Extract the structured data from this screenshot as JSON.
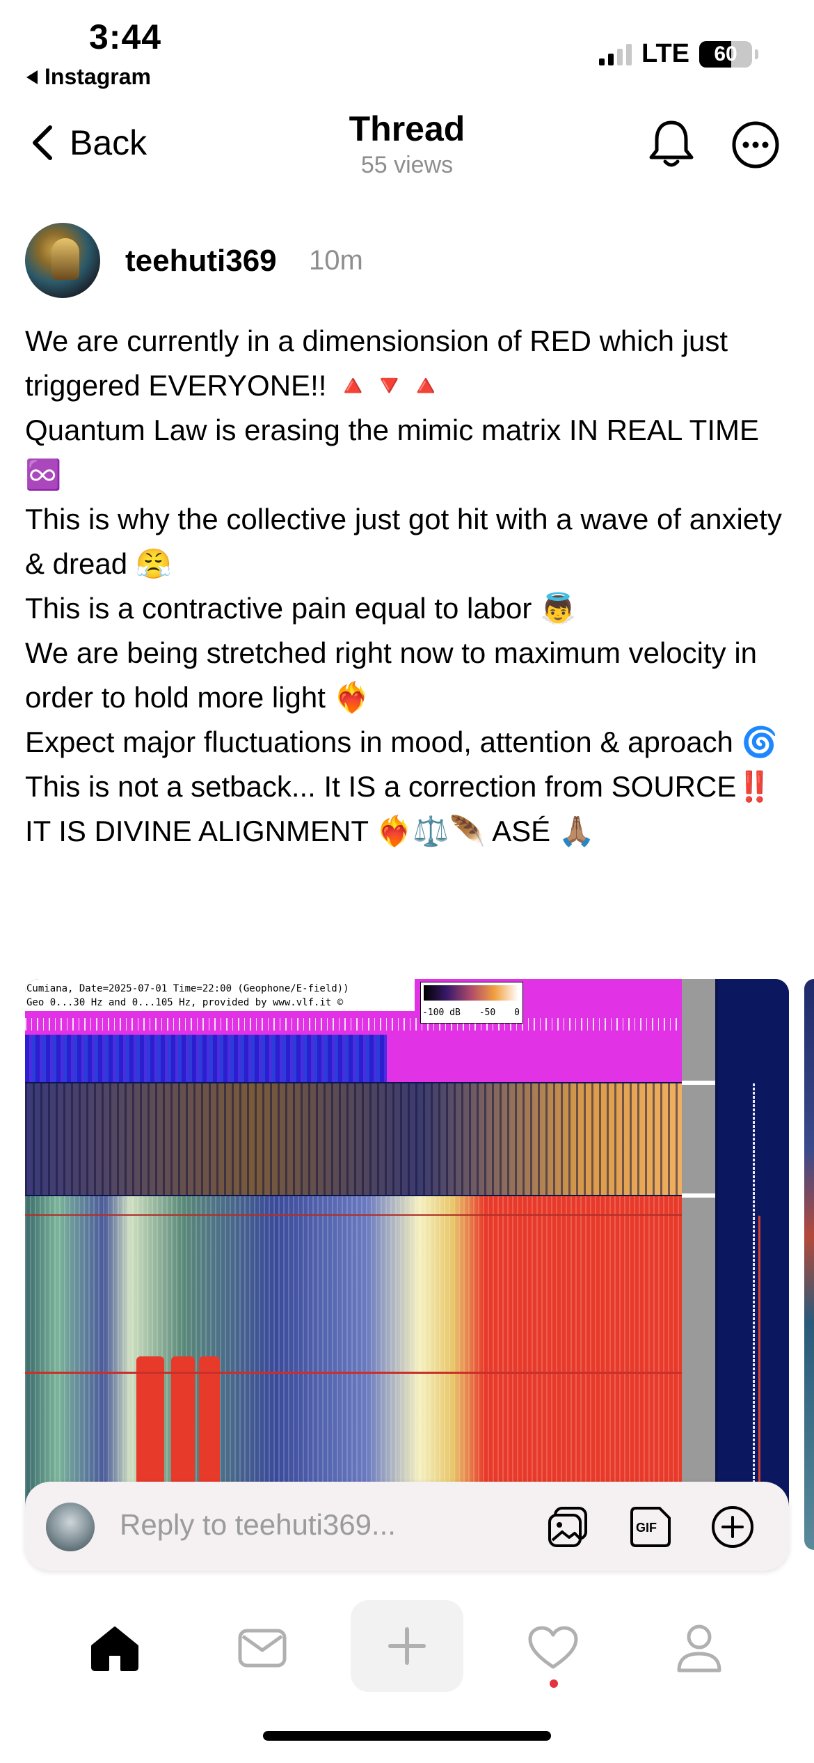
{
  "status_bar": {
    "time": "3:44",
    "back_app": "Instagram",
    "network": "LTE",
    "battery": "60",
    "battery_level": 0.6
  },
  "nav": {
    "back_label": "Back",
    "title": "Thread",
    "subtitle": "55 views",
    "icons": [
      "chevron-left-icon",
      "bell-icon",
      "more-icon"
    ]
  },
  "post": {
    "username": "teehuti369",
    "time": "10m",
    "lines": [
      "We are currently in a dimensionsion of RED which just triggered EVERYONE!! 🔺🔻🔺",
      "Quantum Law is erasing the mimic matrix IN REAL TIME ♾️",
      "This is why the collective just got hit with a wave of anxiety & dread 😤",
      "This is a contractive pain equal to labor 👼",
      "We are being stretched right now to maximum velocity in order to hold more light ❤️‍🔥",
      "Expect major fluctuations in mood, attention & aproach 🌀",
      "This is not a setback... It IS a correction from SOURCE‼️",
      "IT IS DIVINE ALIGNMENT ❤️‍🔥⚖️🪶 ASÉ 🙏🏽"
    ],
    "media": {
      "caption_line1": "Cumiana, Date=2025-07-01 Time=22:00 (Geophone/E-field))",
      "caption_line2": "Geo 0...30 Hz and 0...105 Hz, provided by www.vlf.it ©",
      "colorbar_labels": [
        "-100 dB",
        "-50",
        "0"
      ]
    }
  },
  "reply": {
    "placeholder": "Reply to teehuti369...",
    "icons": [
      "image-icon",
      "gif-icon",
      "plus-circle-icon"
    ]
  },
  "tabbar": {
    "icons": [
      "home-icon",
      "inbox-icon",
      "new-post-icon",
      "activity-heart-icon",
      "profile-icon"
    ]
  },
  "colors": {
    "accent_red": "#e5323f",
    "secondary_text": "#8e8e8e"
  }
}
